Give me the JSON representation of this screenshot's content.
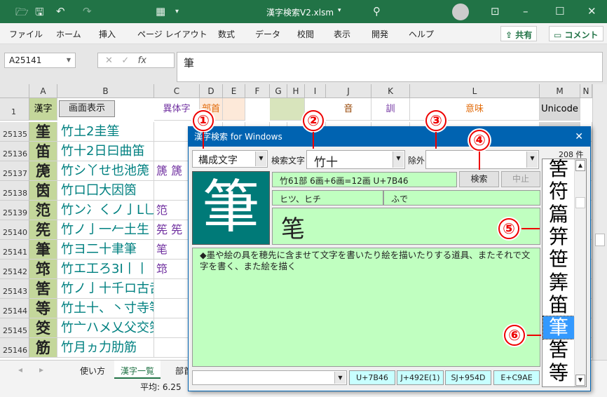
{
  "window": {
    "title": "漢字検索V2.xlsm",
    "title_caret": "▾"
  },
  "ribbon": {
    "tabs": [
      "ファイル",
      "ホーム",
      "挿入",
      "ページ レイアウト",
      "数式",
      "データ",
      "校閲",
      "表示",
      "開発",
      "ヘルプ"
    ],
    "share": "共有",
    "comment": "コメント"
  },
  "formula": {
    "name_box": "A25141",
    "content": "筆",
    "fx": "fx"
  },
  "columns": [
    "A",
    "B",
    "C",
    "D",
    "E",
    "F",
    "G",
    "H",
    "I",
    "J",
    "K",
    "L",
    "M",
    "N"
  ],
  "header_row": {
    "num": "1",
    "kanji": "漢字",
    "screen_button": "画面表示",
    "variant": "異体字",
    "radical": "部首",
    "on": "音",
    "kun": "訓",
    "meaning": "意味",
    "unicode": "Unicode"
  },
  "rows": [
    {
      "n": "25135",
      "k": "筀",
      "d": "竹土2圭筀",
      "v": ""
    },
    {
      "n": "25136",
      "k": "笛",
      "d": "竹十2日曰曲笛",
      "v": ""
    },
    {
      "n": "25137",
      "k": "箎",
      "d": "竹シ丫せ也池箎",
      "v": "篪 篪"
    },
    {
      "n": "25138",
      "k": "筃",
      "d": "竹ロ囗大因筃",
      "v": ""
    },
    {
      "n": "25139",
      "k": "笵",
      "d": "竹ン冫くノ亅L乚",
      "v": "笵"
    },
    {
      "n": "25140",
      "k": "筅",
      "d": "竹ノ亅一𠂉土生",
      "v": "筅 筅"
    },
    {
      "n": "25141",
      "k": "筆",
      "d": "竹ヨ二十聿筆",
      "v": "笔"
    },
    {
      "n": "25142",
      "k": "筇",
      "d": "竹エ工ろ3I丨丨",
      "v": "筇"
    },
    {
      "n": "25143",
      "k": "筈",
      "d": "竹ノ亅十千ロ古舌筈",
      "v": ""
    },
    {
      "n": "25144",
      "k": "等",
      "d": "竹土十、丶寸寺等",
      "v": ""
    },
    {
      "n": "25145",
      "k": "筊",
      "d": "竹亠ハメ乂父交筊",
      "v": ""
    },
    {
      "n": "25146",
      "k": "筋",
      "d": "竹月ヵ力肋筋",
      "v": ""
    }
  ],
  "sheet_tabs": [
    "使い方",
    "漢字一覧",
    "部首"
  ],
  "status": {
    "average": "平均: 6.25"
  },
  "dialog": {
    "title": "漢字検索 for Windows",
    "mode": "構成文字",
    "search_label": "検索文字",
    "search_value": "竹十",
    "exclude_label": "除外",
    "exclude_value": "",
    "count": "208 件",
    "search_button": "検索",
    "stop_button": "中止",
    "big_kanji": "筆",
    "info": "竹61部 6画+6画=12画 U+7B46",
    "on": "ヒツ、ヒチ",
    "kun": "ふで",
    "variant": "笔",
    "meaning": "◆墨や絵の具を穂先に含ませて文字を書いたり絵を描いたりする道具、またそれで文字を書く、また絵を描く",
    "bottom_combo": "",
    "codes": [
      "U+7B46",
      "J+492E(1)",
      "SJ+954D",
      "E+C9AE"
    ],
    "results": [
      "筈",
      "符",
      "篇",
      "笄",
      "笹",
      "筭",
      "笛",
      "筆",
      "筈",
      "等"
    ],
    "selected_index": 7
  },
  "annotations": [
    "①",
    "②",
    "③",
    "④",
    "⑤",
    "⑥"
  ],
  "colors": {
    "excel_green": "#217346",
    "dialog_blue": "#0063b1",
    "teal": "#007a78",
    "info_green": "#c0ffc0",
    "code_cyan": "#c8ffff",
    "annotation_red": "#e00000"
  }
}
